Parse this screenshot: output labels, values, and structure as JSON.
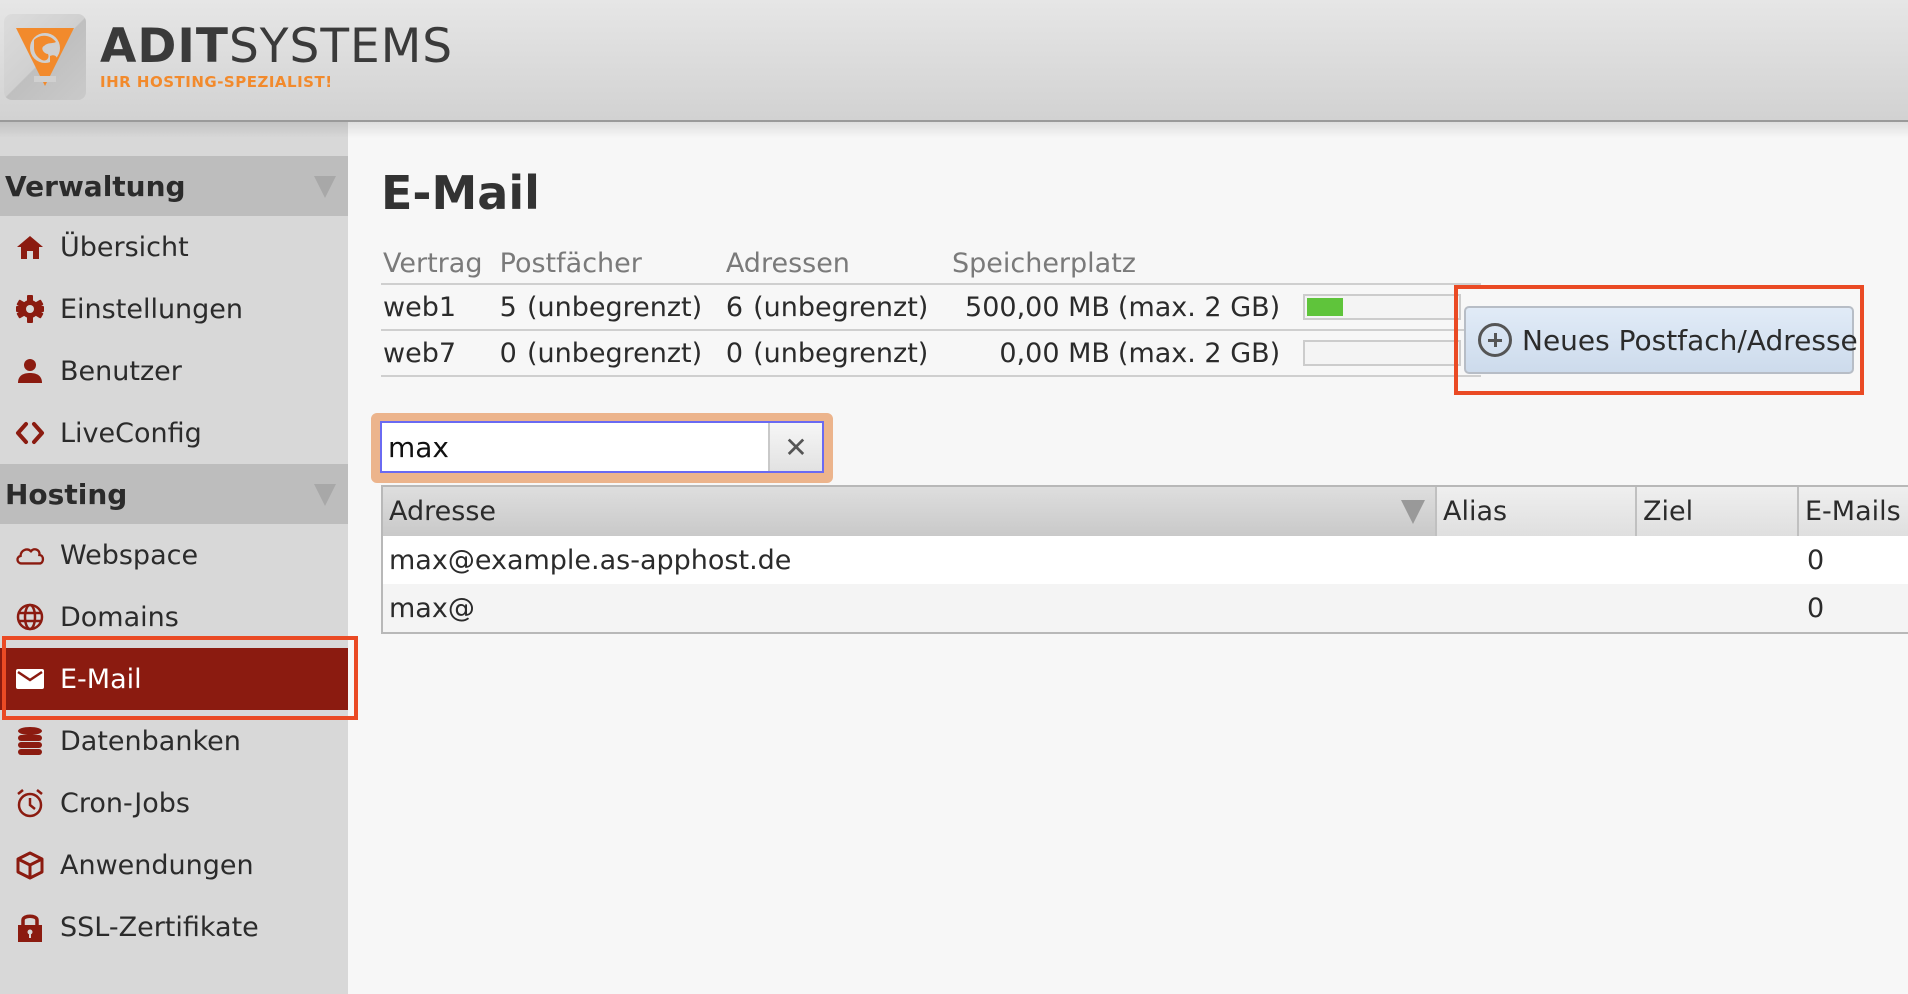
{
  "header": {
    "brand_bold": "ADIT",
    "brand_light": "SYSTEMS",
    "slogan": "IHR HOSTING-SPEZIALIST!",
    "logo_icon": "globe-triangle-logo-icon"
  },
  "sidebar": {
    "sections": [
      {
        "title": "Verwaltung",
        "items": [
          {
            "label": "Übersicht",
            "icon": "home-icon"
          },
          {
            "label": "Einstellungen",
            "icon": "gear-icon"
          },
          {
            "label": "Benutzer",
            "icon": "user-icon"
          },
          {
            "label": "LiveConfig",
            "icon": "liveconfig-icon"
          }
        ]
      },
      {
        "title": "Hosting",
        "items": [
          {
            "label": "Webspace",
            "icon": "cloud-icon"
          },
          {
            "label": "Domains",
            "icon": "globe-icon"
          },
          {
            "label": "E-Mail",
            "icon": "envelope-icon",
            "active": true
          },
          {
            "label": "Datenbanken",
            "icon": "database-icon"
          },
          {
            "label": "Cron-Jobs",
            "icon": "alarm-clock-icon"
          },
          {
            "label": "Anwendungen",
            "icon": "package-icon"
          },
          {
            "label": "SSL-Zertifikate",
            "icon": "lock-icon"
          }
        ]
      }
    ]
  },
  "main": {
    "title": "E-Mail",
    "stats": {
      "headers": [
        "Vertrag",
        "Postfächer",
        "Adressen",
        "Speicherplatz"
      ],
      "rows": [
        {
          "vertrag": "web1",
          "postfaecher": "5",
          "postfaecher_limit": "(unbegrenzt)",
          "adressen": "6",
          "adressen_limit": "(unbegrenzt)",
          "speicher": "500,00 MB",
          "speicher_max": "(max. 2 GB)",
          "usage_fraction": 0.24
        },
        {
          "vertrag": "web7",
          "postfaecher": "0",
          "postfaecher_limit": "(unbegrenzt)",
          "adressen": "0",
          "adressen_limit": "(unbegrenzt)",
          "speicher": "0,00 MB",
          "speicher_max": "(max. 2 GB)",
          "usage_fraction": 0.0
        }
      ]
    },
    "new_button_label": "Neues Postfach/Adresse",
    "search": {
      "value": "max",
      "clear_label": "✕"
    },
    "grid": {
      "columns": [
        "Adresse",
        "Alias",
        "Ziel",
        "E-Mails"
      ],
      "rows": [
        {
          "adresse": "max@example.as-apphost.de",
          "alias": "",
          "ziel": "",
          "emails": "0"
        },
        {
          "adresse": "max@",
          "alias": "",
          "ziel": "",
          "emails": "0"
        }
      ]
    }
  },
  "colors": {
    "accent": "#8b1b10",
    "highlight": "#ea4a24",
    "progress": "#5fc43b",
    "brand_orange": "#f28a2c"
  }
}
